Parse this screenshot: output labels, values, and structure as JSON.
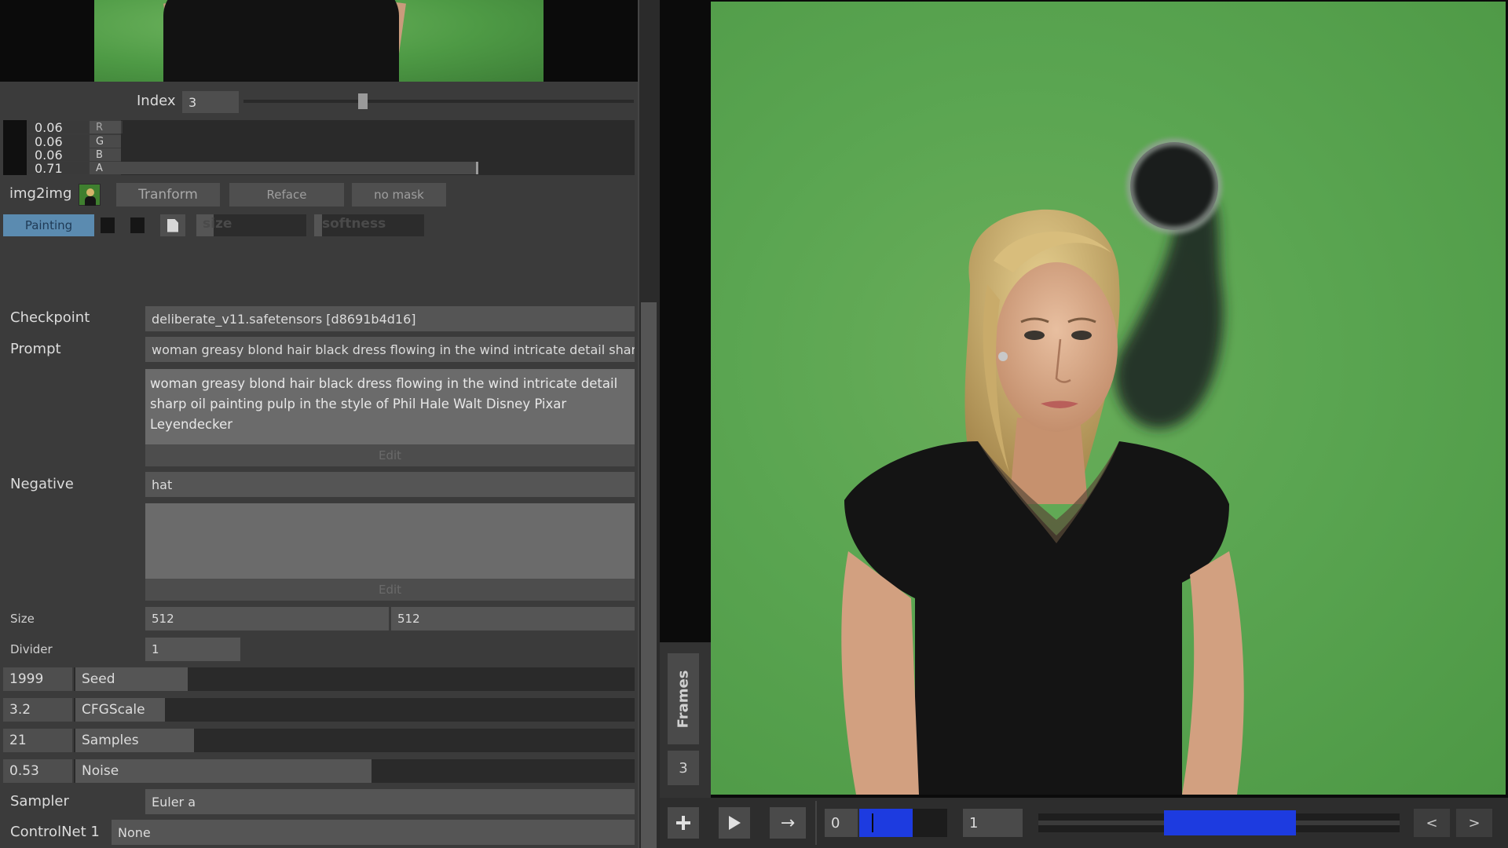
{
  "index": {
    "label": "Index",
    "value": "3",
    "slider_fraction": 0.29
  },
  "rgba": [
    {
      "value": "0.06",
      "letter": "R",
      "fraction": 0.06
    },
    {
      "value": "0.06",
      "letter": "G",
      "fraction": 0.06
    },
    {
      "value": "0.06",
      "letter": "B",
      "fraction": 0.06
    },
    {
      "value": "0.71",
      "letter": "A",
      "fraction": 0.71
    }
  ],
  "toolbar": {
    "mode_label": "img2img",
    "transform_label": "Tranform",
    "reface_label": "Reface",
    "mask_label": "no mask",
    "painting_label": "Painting",
    "size_label": "size",
    "softness_label": "softness"
  },
  "form": {
    "checkpoint_label": "Checkpoint",
    "checkpoint_value": "deliberate_v11.safetensors [d8691b4d16]",
    "prompt_label": "Prompt",
    "prompt_value": "woman greasy blond hair black dress flowing in the wind intricate detail sharp",
    "prompt_full": "woman greasy blond hair black dress flowing in the wind intricate detail sharp oil painting pulp in the style of Phil Hale Walt Disney Pixar Leyendecker",
    "edit_label": "Edit",
    "negative_label": "Negative",
    "negative_value": "hat",
    "negative_full": "",
    "size_label": "Size",
    "width_value": "512",
    "height_value": "512",
    "divider_label": "Divider",
    "divider_value": "1"
  },
  "sliders": [
    {
      "value": "1999",
      "label": "Seed",
      "fraction": 0.05
    },
    {
      "value": "3.2",
      "label": "CFGScale",
      "fraction": 0.0
    },
    {
      "value": "21",
      "label": "Samples",
      "fraction": 0.07
    },
    {
      "value": "0.53",
      "label": "Noise",
      "fraction": 0.53
    }
  ],
  "sampler": {
    "label": "Sampler",
    "value": "Euler a"
  },
  "controlnet": {
    "label": "ControlNet 1",
    "value": "None"
  },
  "frames": {
    "tab_label": "Frames",
    "count": "3"
  },
  "timeline": {
    "start_value": "0",
    "end_value": "1",
    "prev_label": "<",
    "next_label": ">",
    "accent": "#1d3be0"
  },
  "colors": {
    "background": "#3c3c3c",
    "green_screen": "#5aa551",
    "accent_blue": "#1d3be0",
    "painting_active": "#5b8bb0"
  }
}
